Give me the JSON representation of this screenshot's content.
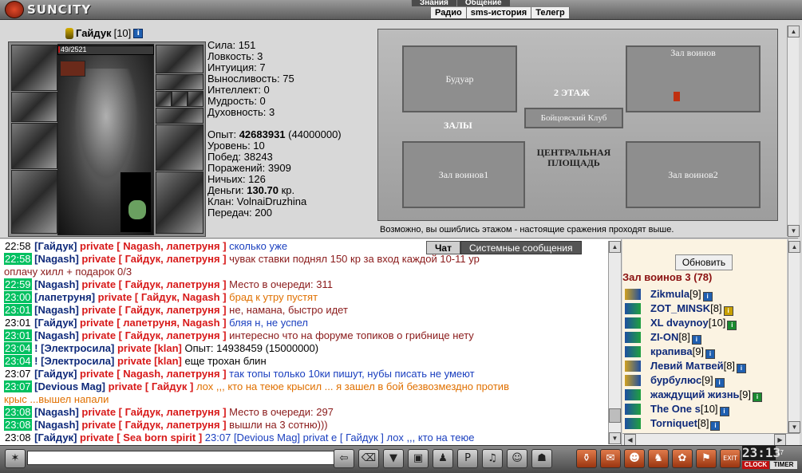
{
  "logo": {
    "text": "SUNCITY"
  },
  "top_menu": [
    "Знания",
    "Общение"
  ],
  "sub_menu": [
    "Радио",
    "sms-история",
    "Телегр"
  ],
  "character": {
    "name": "Гайдук",
    "level": "[10]",
    "hp_text": "49/2521",
    "hp_current": 49,
    "hp_max": 2521,
    "stats": [
      "Сила: 151",
      "Ловкость: 3",
      "Интуиция: 7",
      "Выносливость: 75",
      "Интеллект: 0",
      "Мудрость: 0",
      "Духовность: 3"
    ],
    "exp_label": "Опыт: ",
    "exp_value": "42683931",
    "exp_next": " (44000000)",
    "details_a": [
      "Уровень: 10",
      "Побед: 38243",
      "Поражений: 3909",
      "Ничьих: 126"
    ],
    "money_label": "Деньги: ",
    "money_value": "130.70",
    "money_unit": " кр.",
    "details_b": [
      "Клан: VolnaiDruzhina",
      "Передач: 200"
    ]
  },
  "map": {
    "rooms": {
      "budoir": "Будуар",
      "top_right": "Зал воинов",
      "floor": "2 ЭТАЖ",
      "club": "Бойцовский Клуб",
      "halls": "ЗАЛЫ",
      "central": "ЦЕНТРАЛЬНАЯ ПЛОЩАДЬ",
      "hall1": "Зал воинов1",
      "hall2": "Зал воинов2"
    },
    "caption": "Возможно, вы ошиблись этажом - настоящие сражения проходят выше."
  },
  "chat_tabs": {
    "chat": "Чат",
    "system": "Системные сообщения"
  },
  "chat": [
    {
      "time": "22:58",
      "hl": false,
      "from": "[Гайдук]",
      "priv": "private [ Nagash, лапетруня ]",
      "msg": " сколько уже",
      "color": "#1a3fbf"
    },
    {
      "time": "22:58",
      "hl": true,
      "from": "[Nagash]",
      "priv": "private [ Гайдук, лапетруня ]",
      "msg": " чувак ставки поднял 150 кр за вход каждой 10-11 ур",
      "color": "#8a1a1a"
    },
    {
      "time": "",
      "hl": false,
      "from": "",
      "priv": "",
      "msg": "оплачу хилл + подарок 0/3",
      "color": "#8a1a1a"
    },
    {
      "time": "22:59",
      "hl": true,
      "from": "[Nagash]",
      "priv": "private [ Гайдук, лапетруня ]",
      "msg": " Место в очереди: 311",
      "color": "#8a1a1a"
    },
    {
      "time": "23:00",
      "hl": true,
      "from": "[лапетруня]",
      "priv": "private [ Гайдук, Nagash ]",
      "msg": " брад к утру пустят",
      "color": "#e07000"
    },
    {
      "time": "23:01",
      "hl": true,
      "from": "[Nagash]",
      "priv": "private [ Гайдук, лапетруня ]",
      "msg": " не, намана, быстро идет",
      "color": "#8a1a1a"
    },
    {
      "time": "23:01",
      "hl": false,
      "from": "[Гайдук]",
      "priv": "private [ лапетруня, Nagash ]",
      "msg": " бляя н, не успел",
      "color": "#1a3fbf"
    },
    {
      "time": "23:01",
      "hl": true,
      "from": "[Nagash]",
      "priv": "private [ Гайдук, лапетруня ]",
      "msg": " интересно что на форуме топиков о грибнице нету",
      "color": "#8a1a1a"
    },
    {
      "time": "23:04",
      "hl": true,
      "from": "! [Электросила]",
      "priv": "private [klan]",
      "msg": " Опыт: 14938459 (15000000)",
      "color": "#000000"
    },
    {
      "time": "23:04",
      "hl": true,
      "from": "! [Электросила]",
      "priv": "private [klan]",
      "msg": " еще трохан блин",
      "color": "#000000"
    },
    {
      "time": "23:07",
      "hl": false,
      "from": "[Гайдук]",
      "priv": "private [ Nagash, лапетруня ]",
      "msg": " так топы только 10ки пишут, нубы писать не умеют",
      "color": "#1a3fbf"
    },
    {
      "time": "23:07",
      "hl": true,
      "from": "[Devious Mag]",
      "priv": "private [ Гайдук ]",
      "msg": " лох ,,, кто на теюе крысил ... я зашел в бой безвозмездно против",
      "color": "#e07000"
    },
    {
      "time": "",
      "hl": false,
      "from": "",
      "priv": "",
      "msg": "крыс ...вышел напали",
      "color": "#e07000"
    },
    {
      "time": "23:08",
      "hl": true,
      "from": "[Nagash]",
      "priv": "private [ Гайдук, лапетруня ]",
      "msg": " Место в очереди: 297",
      "color": "#8a1a1a"
    },
    {
      "time": "23:08",
      "hl": true,
      "from": "[Nagash]",
      "priv": "private [ Гайдук, лапетруня ]",
      "msg": " вышли на 3 сотню)))",
      "color": "#8a1a1a"
    },
    {
      "time": "23:08",
      "hl": false,
      "from": "[Гайдук]",
      "priv": "private [ Sea born spirit ]",
      "msg": " 23:07 [Devious Mag] privat е [ Гайдук ] лох ,,, кто на теюе",
      "color": "#1a3fbf"
    },
    {
      "time": "",
      "hl": false,
      "from": "",
      "priv": "",
      "msg": "крысил ... я зашел в бой безвозмездно против крыс ...вышел напали",
      "color": "#1a3fbf"
    }
  ],
  "users_panel": {
    "refresh_label": "Обновить",
    "room_title": "Зал воинов 3 (78)",
    "users": [
      {
        "name": "Zikmula",
        "level": "[9]",
        "icon": "a",
        "lv": "#1f5fb0"
      },
      {
        "name": "ZOT_MINSK",
        "level": "[8]",
        "icon": "b",
        "lv": "#c8a000"
      },
      {
        "name": "XL dvaynoy",
        "level": "[10]",
        "icon": "b",
        "lv": "#1a8a30"
      },
      {
        "name": "ZI-ON",
        "level": "[8]",
        "icon": "b",
        "lv": "#1f5fb0"
      },
      {
        "name": "крапива",
        "level": "[9]",
        "icon": "b",
        "lv": "#1f5fb0"
      },
      {
        "name": "Левий Матвей",
        "level": "[8]",
        "icon": "a",
        "lv": "#1f5fb0"
      },
      {
        "name": "бурбулюс",
        "level": "[9]",
        "icon": "a",
        "lv": "#1f5fb0"
      },
      {
        "name": "жаждущий жизнь",
        "level": "[9]",
        "icon": "b",
        "lv": "#1a8a30"
      },
      {
        "name": "The One s",
        "level": "[10]",
        "icon": "b",
        "lv": "#1f5fb0"
      },
      {
        "name": "Torniquet",
        "level": "[8]",
        "icon": "b",
        "lv": "#1f5fb0"
      }
    ]
  },
  "clock": {
    "time": "23:13",
    "seconds": "17",
    "clock_label": "CLOCK",
    "timer_label": "TIMER"
  },
  "input": {
    "value": ""
  },
  "toolbar_icons": [
    "arrow-left-icon",
    "eraser-icon",
    "filter-icon",
    "save-icon",
    "dance-icon",
    "pl-icon",
    "music-icon",
    "smile-icon",
    "ghost-icon"
  ],
  "action_icons": [
    "bottle-icon",
    "scroll-icon",
    "mask-icon",
    "cat-icon",
    "gift-icon",
    "flag-icon",
    "exit-icon"
  ],
  "exit_label": "EXIT"
}
